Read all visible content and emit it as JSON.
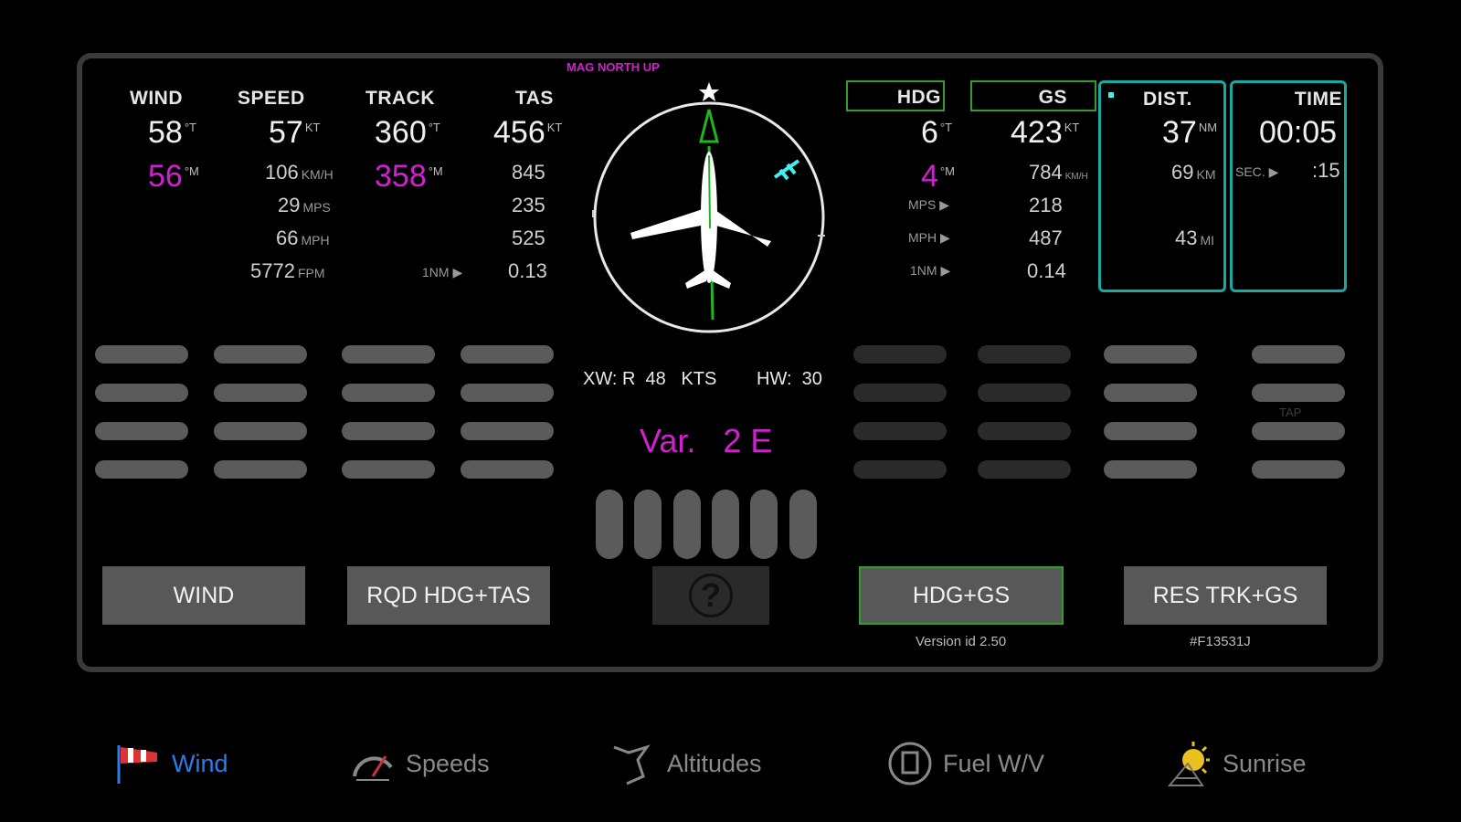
{
  "header": {
    "orientation_label": "MAG NORTH UP"
  },
  "left": {
    "wind": {
      "label": "WIND",
      "true_value": "58",
      "true_unit": "°T",
      "mag_value": "56",
      "mag_unit": "°M"
    },
    "speed": {
      "label": "SPEED",
      "value": "57",
      "unit": "KT",
      "rows": [
        {
          "value": "106",
          "unit": "KM/H"
        },
        {
          "value": "29",
          "unit": "MPS"
        },
        {
          "value": "66",
          "unit": "MPH"
        },
        {
          "value": "5772",
          "unit": "FPM"
        }
      ]
    },
    "track": {
      "label": "TRACK",
      "true_value": "360",
      "true_unit": "°T",
      "mag_value": "358",
      "mag_unit": "°M",
      "nm_label": "1NM ▶"
    },
    "tas": {
      "label": "TAS",
      "value": "456",
      "unit": "KT",
      "rows": [
        "845",
        "235",
        "525",
        "0.13"
      ]
    }
  },
  "right": {
    "hdg": {
      "label": "HDG",
      "true_value": "6",
      "true_unit": "°T",
      "mag_value": "4",
      "mag_unit": "°M",
      "row_labels": [
        "MPS ▶",
        "MPH ▶",
        "1NM ▶"
      ]
    },
    "gs": {
      "label": "GS",
      "value": "423",
      "unit": "KT",
      "rows": [
        "784",
        "218",
        "487",
        "0.14"
      ],
      "row1_unit": "KM/H"
    },
    "dist": {
      "label": "DIST.",
      "value": "37",
      "unit": "NM",
      "rows": [
        {
          "value": "69",
          "unit": "KM"
        },
        {
          "value": "43",
          "unit": "MI"
        }
      ]
    },
    "time": {
      "label": "TIME",
      "value": "00:05",
      "sec_label": "SEC. ▶",
      "sec_value": ":15"
    }
  },
  "center": {
    "crosswind_text": "XW: R  48   KTS",
    "headwind_text": "HW:  30",
    "variation_text": "Var.   2 E",
    "help_symbol": "?"
  },
  "tap_hint": "TAP",
  "buttons": {
    "wind": "WIND",
    "rqd_hdg_tas": "RQD HDG+TAS",
    "hdg_gs": "HDG+GS",
    "res_trk_gs": "RES TRK+GS"
  },
  "footer": {
    "version": "Version id 2.50",
    "build": "#F13531J"
  },
  "tabs": [
    {
      "label": "Wind",
      "icon": "windsock-icon",
      "active": true
    },
    {
      "label": "Speeds",
      "icon": "speedometer-icon",
      "active": false
    },
    {
      "label": "Altitudes",
      "icon": "altimeter-icon",
      "active": false
    },
    {
      "label": "Fuel W/V",
      "icon": "fuel-icon",
      "active": false
    },
    {
      "label": "Sunrise",
      "icon": "sun-icon",
      "active": false
    }
  ],
  "colors": {
    "magenta": "#d020d0",
    "teal": "#1aa9a0",
    "green": "#2f9e2f",
    "active_tab": "#2e7bea"
  }
}
